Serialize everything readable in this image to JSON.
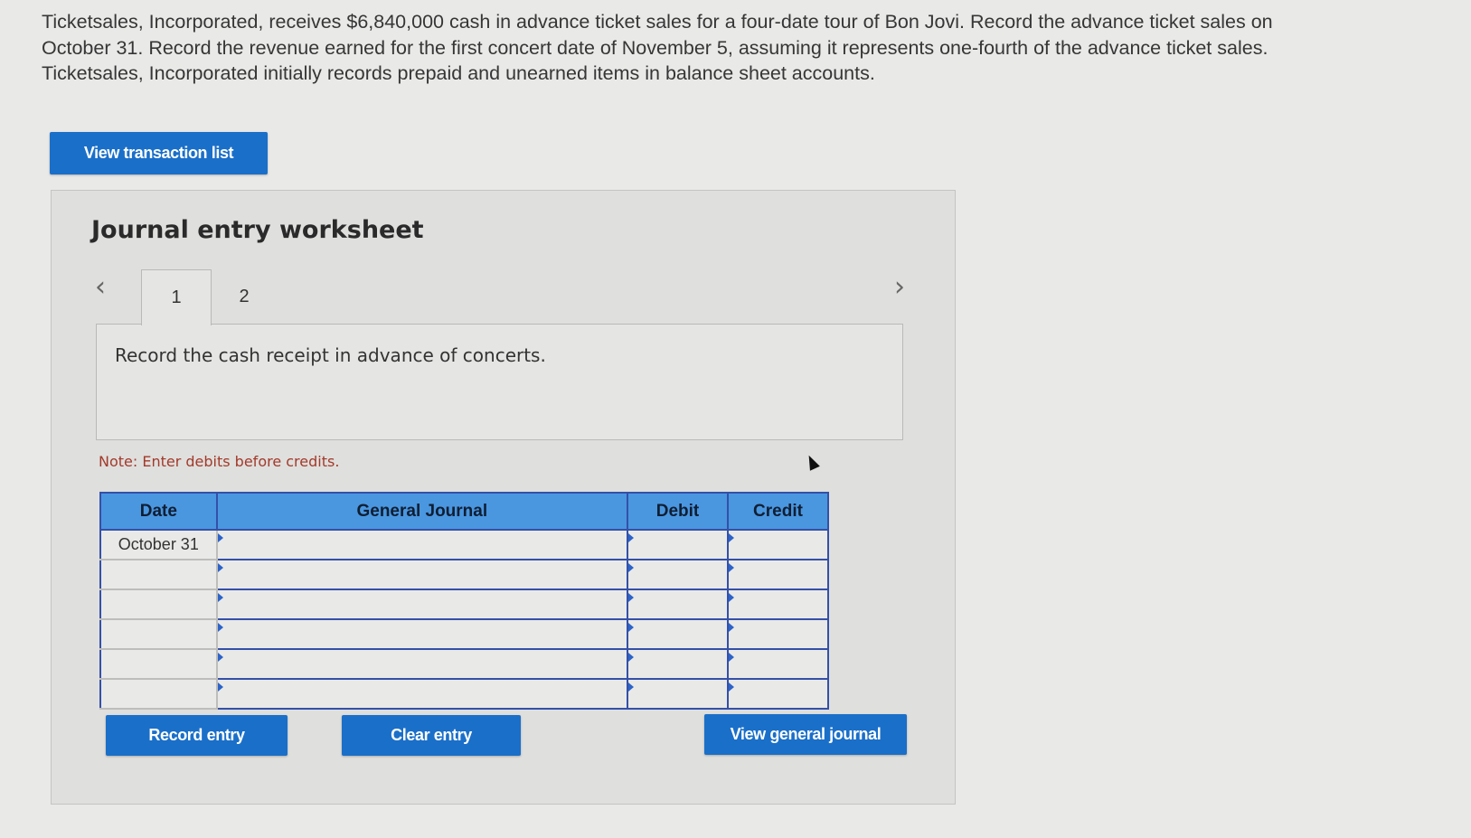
{
  "problem": {
    "text": "Ticketsales, Incorporated, receives $6,840,000 cash in advance ticket sales for a four-date tour of Bon Jovi. Record the advance ticket sales on October 31. Record the revenue earned for the first concert date of November 5, assuming it represents one-fourth of the advance ticket sales. Ticketsales, Incorporated initially records prepaid and unearned items in balance sheet accounts."
  },
  "buttons": {
    "view_transaction_list": "View transaction list",
    "record_entry": "Record entry",
    "clear_entry": "Clear entry",
    "view_general_journal": "View general journal"
  },
  "worksheet": {
    "title": "Journal entry worksheet",
    "prev_icon": "‹",
    "next_icon": "›",
    "tabs": [
      "1",
      "2"
    ],
    "active_tab": "1",
    "instruction": "Record the cash receipt in advance of concerts.",
    "note": "Note: Enter debits before credits."
  },
  "journal": {
    "headers": {
      "date": "Date",
      "general_journal": "General Journal",
      "debit": "Debit",
      "credit": "Credit"
    },
    "rows": [
      {
        "date": "October 31",
        "account": "",
        "debit": "",
        "credit": ""
      },
      {
        "date": "",
        "account": "",
        "debit": "",
        "credit": ""
      },
      {
        "date": "",
        "account": "",
        "debit": "",
        "credit": ""
      },
      {
        "date": "",
        "account": "",
        "debit": "",
        "credit": ""
      },
      {
        "date": "",
        "account": "",
        "debit": "",
        "credit": ""
      },
      {
        "date": "",
        "account": "",
        "debit": "",
        "credit": ""
      }
    ]
  },
  "colors": {
    "button_blue": "#1a6fc9",
    "header_blue": "#4a97e0",
    "note_red": "#a23a2a"
  }
}
